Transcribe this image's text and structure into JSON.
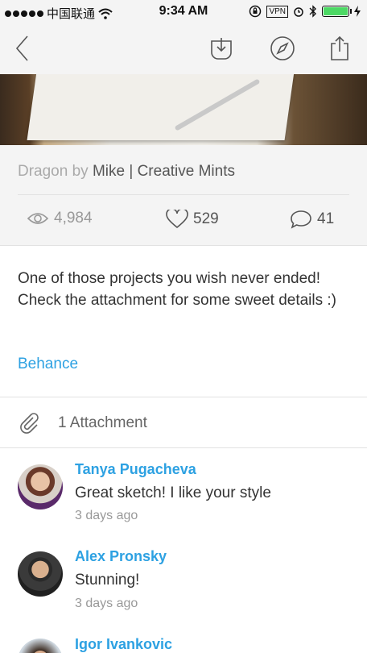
{
  "status_bar": {
    "carrier": "中国联通",
    "time": "9:34 AM",
    "vpn": "VPN",
    "battery_level": 1.0
  },
  "nav": {
    "back_icon": "chevron-left-icon",
    "save_icon": "tray-download-icon",
    "browser_icon": "compass-icon",
    "share_icon": "share-icon"
  },
  "shot": {
    "title": "Dragon",
    "by_word": "by",
    "author": "Mike | Creative Mints",
    "views": "4,984",
    "likes": "529",
    "comments": "41"
  },
  "description": {
    "text": "One of those projects you wish never ended! Check the attachment for some sweet details :)",
    "link_label": "Behance"
  },
  "attachments": {
    "label": "1 Attachment"
  },
  "comments": [
    {
      "name": "Tanya Pugacheva",
      "text": "Great sketch! I like your style",
      "time": "3 days ago"
    },
    {
      "name": "Alex Pronsky",
      "text": "Stunning!",
      "time": "3 days ago"
    },
    {
      "name": "Igor Ivankovic",
      "text": "",
      "time": ""
    }
  ],
  "colors": {
    "accent": "#2da1e2",
    "background": "#f4f4f4",
    "battery": "#4cd964"
  }
}
